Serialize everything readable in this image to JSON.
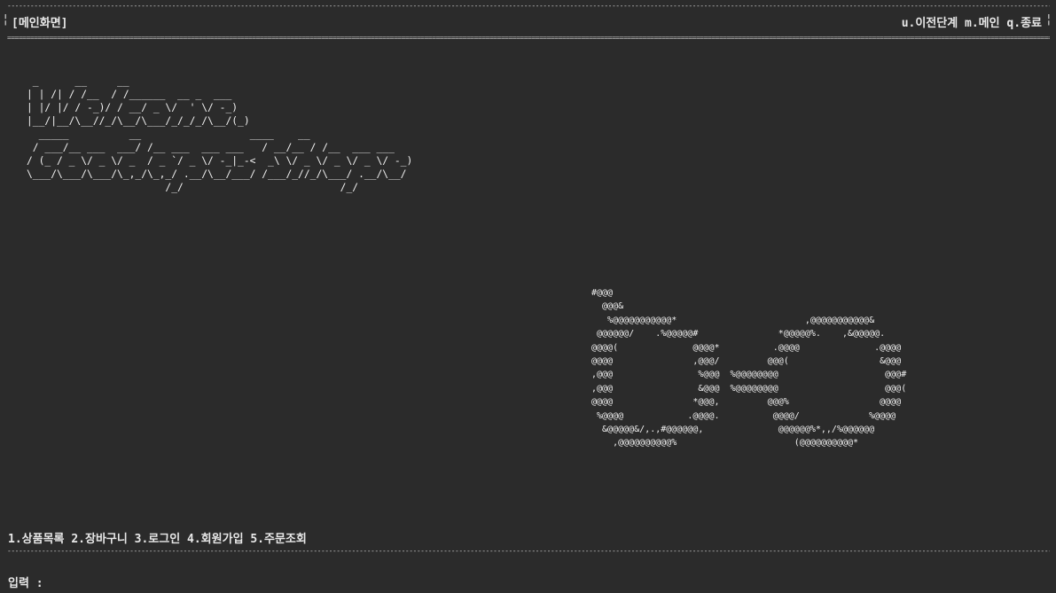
{
  "header": {
    "title": "[메인화면]",
    "pipe": "¦",
    "nav": [
      {
        "key": "u",
        "label": "u.이전단계"
      },
      {
        "key": "m",
        "label": "m.메인"
      },
      {
        "key": "q",
        "label": "q.종료"
      }
    ]
  },
  "rules": {
    "dash": "----------------------------------------------------------------------------------------------------------------------------------------------------------------------------------------------------------------------------------------------------------------------------------------------------",
    "double": "===================================================================================================================================================================================================================================================================================================="
  },
  "banner": {
    "welcome_art": " _      __     __                     \n| | /| / /__  / /______  __ _  ___   \n| |/ |/ / -_)/ / __/ _ \\/  ' \\/ -_)  \n|__/|__/\\__//_/\\__/\\___/_/_/_/\\__/(_)\n  _____          __                  ____    __\n / ___/__ ___  ___/ /__ ___  ___ ___   / __/__ / /__  ___ ___\n/ (_ / _ \\/ _ \\/ _  / _ `/ _ \\/ -_|_-<  _\\ \\/ _ \\/ _ \\/ _ \\/ -_)\n\\___/\\___/\\___/\\_,_/\\_,_/ .__/\\__/___/ /___/_//_/\\___/ .__/\\__/\n                       /_/                          /_/",
    "logo_art": "#@@@\n  @@@&\n   %@@@@@@@@@@@*                        ,@@@@@@@@@@@&\n @@@@@@/    .%@@@@@#               *@@@@@%.    ,&@@@@@.\n@@@@(              @@@@*          .@@@@              .@@@@\n@@@@               ,@@@/         @@@(                 &@@@\n,@@@                %@@@  %@@@@@@@@                    @@@#\n,@@@                &@@@  %@@@@@@@@                    @@@(\n@@@@               *@@@,         @@@%                 @@@@\n %@@@@            .@@@@.          @@@@/             %@@@@\n  &@@@@@&/,.,#@@@@@@,              @@@@@@%*,,/%@@@@@@\n    ,@@@@@@@@@@%                      (@@@@@@@@@@*"
  },
  "menu": {
    "items": [
      {
        "label": "1.상품목록"
      },
      {
        "label": "2.장바구니"
      },
      {
        "label": "3.로그인"
      },
      {
        "label": "4.회원가입"
      },
      {
        "label": "5.주문조회"
      }
    ]
  },
  "prompt": {
    "label": "입력 :",
    "value": ""
  }
}
